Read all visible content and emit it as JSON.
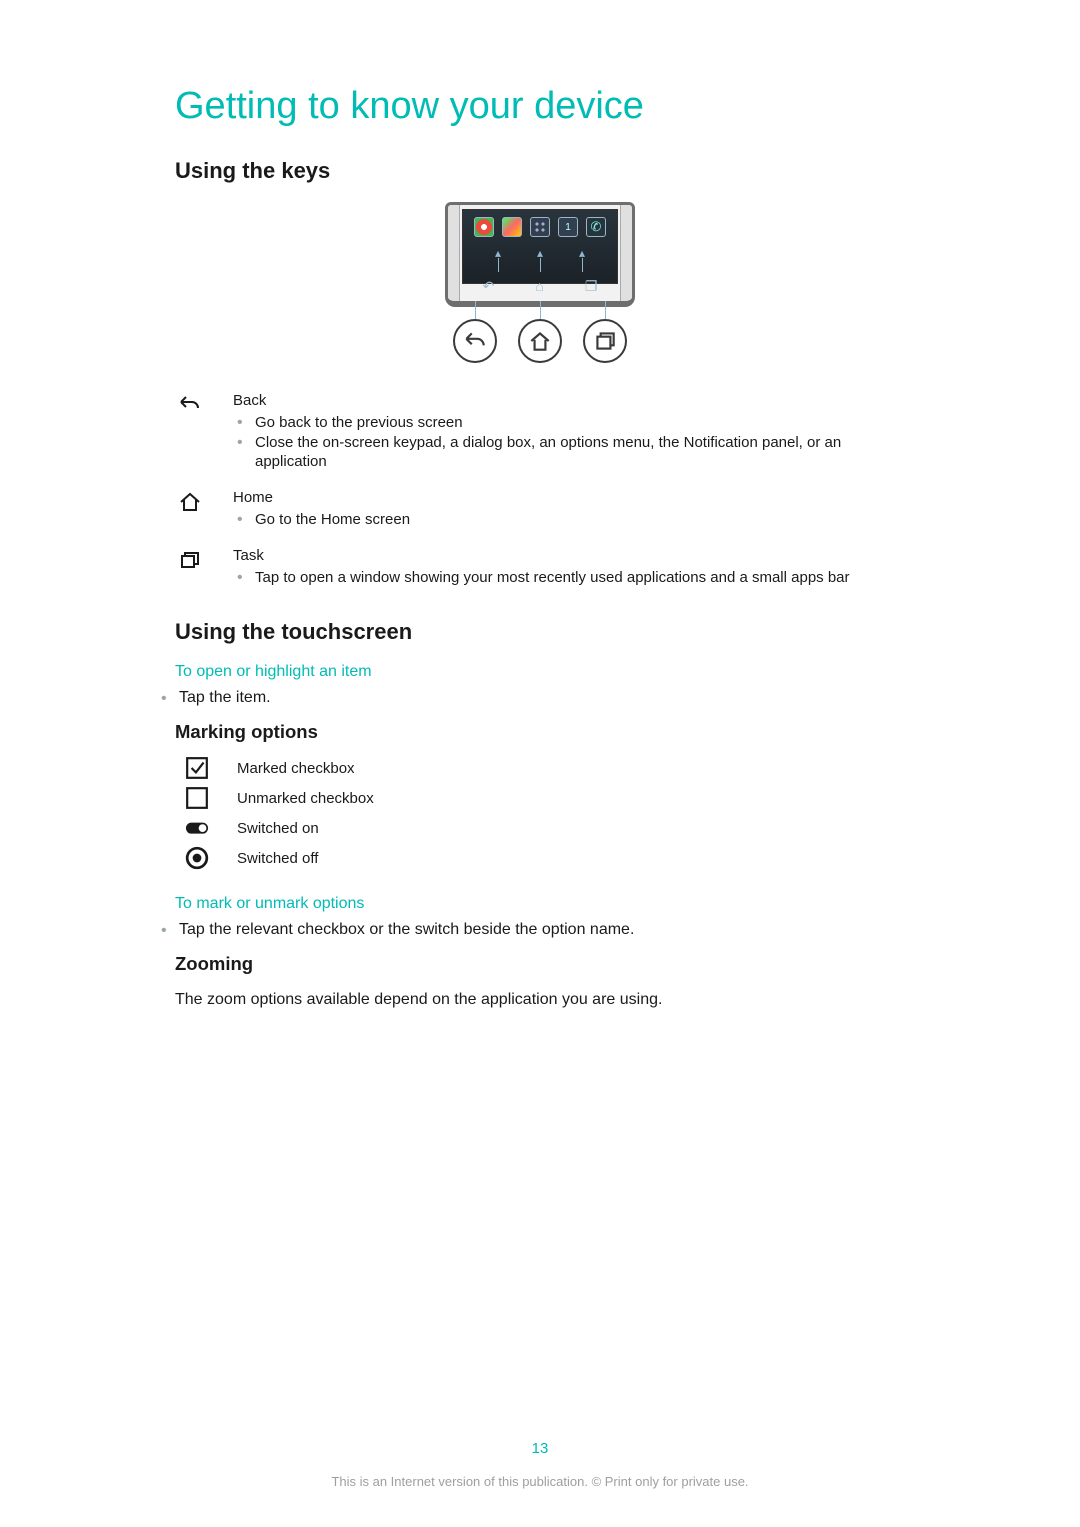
{
  "colors": {
    "accent": "#00bcb4",
    "bullet": "#9aa5ad",
    "text": "#1a1a1a",
    "muted": "#9f9f9f"
  },
  "title": "Getting to know your device",
  "section_keys": {
    "heading": "Using the keys",
    "items": [
      {
        "icon_name": "back-icon",
        "title": "Back",
        "bullets": [
          "Go back to the previous screen",
          "Close the on-screen keypad, a dialog box, an options menu, the Notification panel, or an application"
        ]
      },
      {
        "icon_name": "home-icon",
        "title": "Home",
        "bullets": [
          "Go to the Home screen"
        ]
      },
      {
        "icon_name": "task-icon",
        "title": "Task",
        "bullets": [
          "Tap to open a window showing your most recently used applications and a small apps bar"
        ]
      }
    ]
  },
  "section_touch": {
    "heading": "Using the touchscreen",
    "open_item": {
      "subhead": "To open or highlight an item",
      "bullet": "Tap the item."
    },
    "marking": {
      "heading": "Marking options",
      "rows": [
        {
          "icon_name": "checkbox-checked-icon",
          "label": "Marked checkbox"
        },
        {
          "icon_name": "checkbox-empty-icon",
          "label": "Unmarked checkbox"
        },
        {
          "icon_name": "switch-on-icon",
          "label": "Switched on"
        },
        {
          "icon_name": "switch-off-icon",
          "label": "Switched off"
        }
      ]
    },
    "mark_howto": {
      "subhead": "To mark or unmark options",
      "bullet": "Tap the relevant checkbox or the switch beside the option name."
    },
    "zooming": {
      "heading": "Zooming",
      "text": "The zoom options available depend on the application you are using."
    }
  },
  "page_number": "13",
  "footer": "This is an Internet version of this publication. © Print only for private use."
}
